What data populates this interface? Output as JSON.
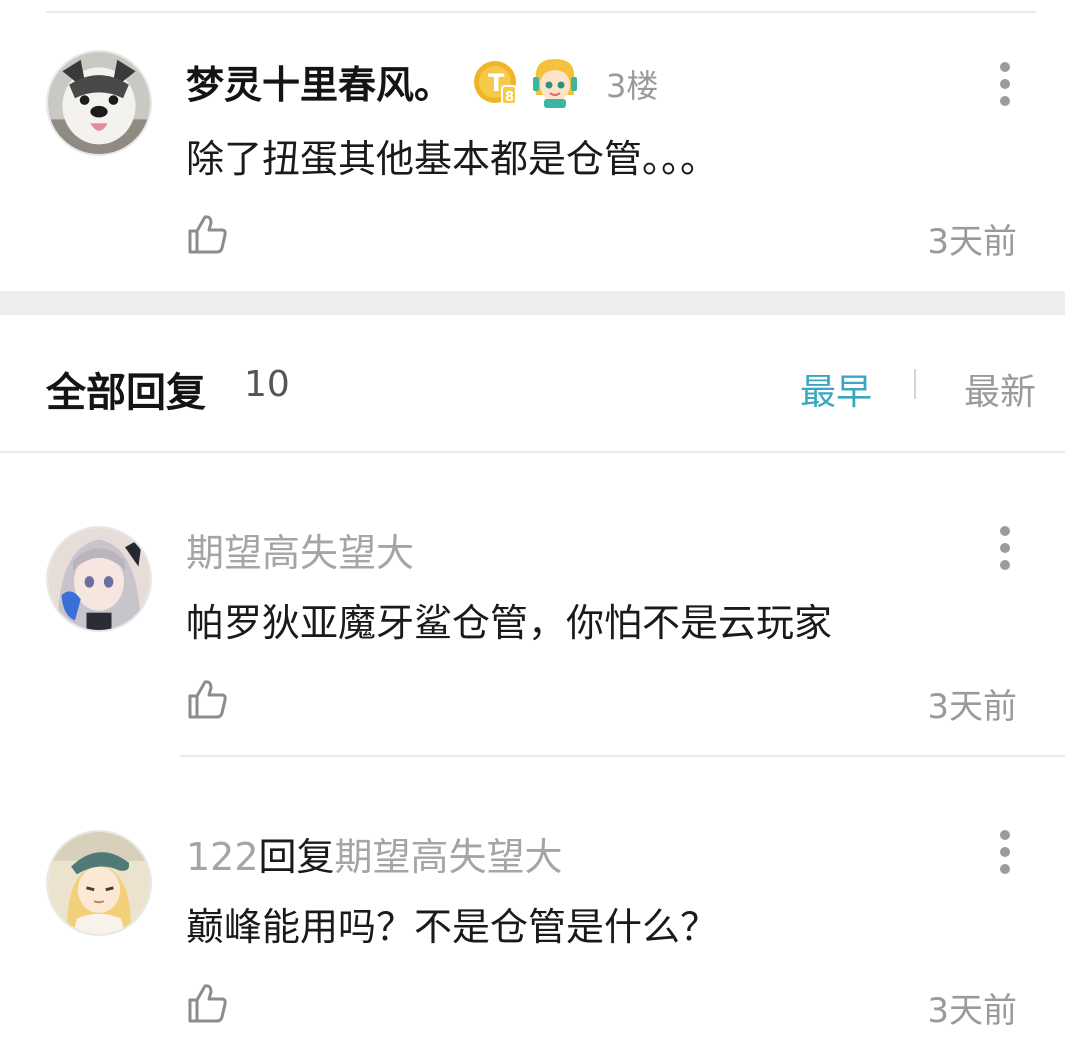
{
  "main_comment": {
    "username": "梦灵十里春风。",
    "floor": "3楼",
    "text": "除了扭蛋其他基本都是仓管。。。",
    "time": "3天前",
    "badge_t_letter": "T",
    "badge_t_number": "8",
    "avatar": "husky-dog-avatar"
  },
  "replies_header": {
    "title": "全部回复",
    "count": "10",
    "sort_earliest": "最早",
    "sort_latest": "最新",
    "active_sort": "最早"
  },
  "replies": [
    {
      "username": "期望高失望大",
      "text": "帕罗狄亚魔牙鲨仓管，你怕不是云玩家",
      "time": "3天前",
      "avatar": "anime-silver-hair-girl-avatar"
    },
    {
      "username_prefix": "122",
      "reply_word": "回复",
      "reply_to": "期望高失望大",
      "text": "巅峰能用吗？不是仓管是什么？",
      "time": "3天前",
      "avatar": "anime-blonde-hat-girl-avatar"
    }
  ],
  "colors": {
    "accent": "#3aa7c0",
    "muted": "#9a9a9a",
    "divider": "#ececec",
    "section_gap": "#ededed",
    "coin_gold": "#f0b429"
  },
  "icons": [
    "more-icon",
    "thumbs-up-icon",
    "coin-badge-icon",
    "level-badge-icon"
  ]
}
